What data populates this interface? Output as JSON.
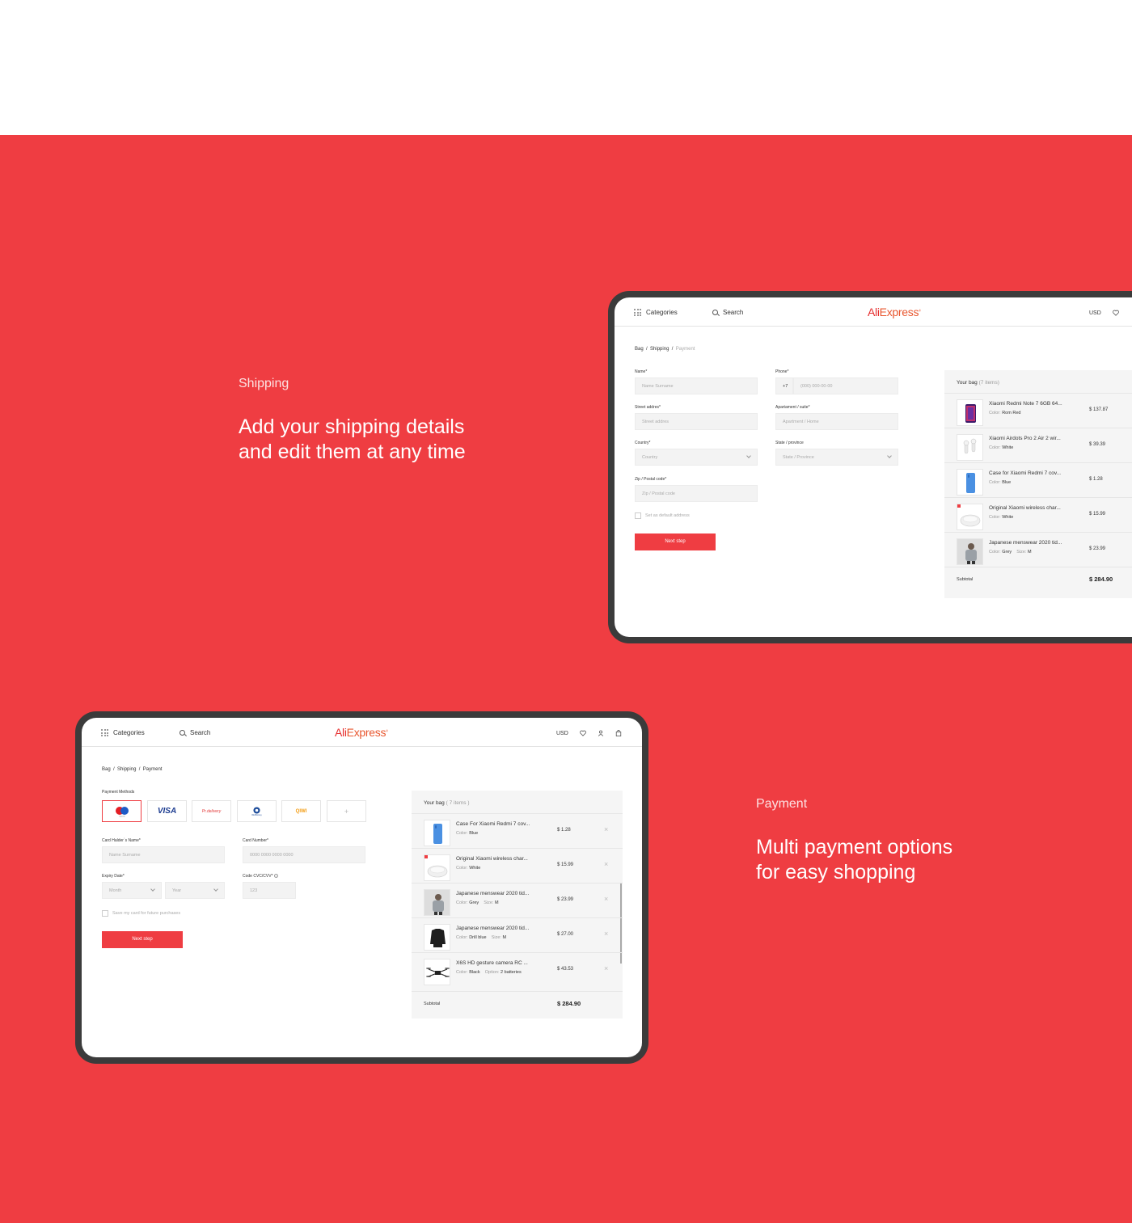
{
  "colors": {
    "accent": "#ef3d42",
    "brand": "#e62e2e",
    "frame": "#3b3b3b"
  },
  "shipping_caption": {
    "label": "Shipping",
    "title_line1": "Add your shipping details",
    "title_line2": "and edit them at any time"
  },
  "payment_caption": {
    "label": "Payment",
    "title_line1": "Multi payment options",
    "title_line2": "for easy shopping"
  },
  "header": {
    "categories": "Categories",
    "search": "Search",
    "logo_left": "Ali",
    "logo_right": "Express",
    "currency": "USD",
    "icons": [
      "heart-icon",
      "user-icon",
      "bag-icon"
    ]
  },
  "breadcrumb": {
    "bag": "Bag",
    "shipping": "Shipping",
    "payment": "Payment",
    "sep": "/"
  },
  "shipping_form": {
    "name_label": "Name*",
    "name_placeholder": "Name Surname",
    "phone_label": "Phone*",
    "phone_code": "+7",
    "phone_placeholder": "(000) 000-00-00",
    "street_label": "Street addres*",
    "street_placeholder": "Street addres",
    "apt_label": "Apartament / suite*",
    "apt_placeholder": "Apartment / Home",
    "country_label": "Country*",
    "country_placeholder": "Country",
    "state_label": "State / province",
    "state_placeholder": "State / Province",
    "zip_label": "Zip / Postal code*",
    "zip_placeholder": "Zip / Postal code",
    "default_label": "Set as default address",
    "next": "Next step"
  },
  "shipping_bag": {
    "title": "Your bag",
    "count": "(7 items)",
    "items": [
      {
        "name": "Xiaomi Redmi Note 7 6GB 64...",
        "color_label": "Color:",
        "color": "Rom Red",
        "price": "$ 137.87"
      },
      {
        "name": "Xiaomi Airdots Pro 2 Air 2 wir...",
        "color_label": "Color:",
        "color": "White",
        "price": "$ 39.39"
      },
      {
        "name": "Case for Xiaomi Redmi 7 cov...",
        "color_label": "Color:",
        "color": "Blue",
        "price": "$ 1.28"
      },
      {
        "name": "Original Xiaomi wireless char...",
        "color_label": "Color:",
        "color": "White",
        "price": "$ 15.99"
      },
      {
        "name": "Japanese menswear 2020 tid...",
        "color_label": "Color:",
        "color": "Grey",
        "size_label": "Size:",
        "size": "M",
        "price": "$ 23.99"
      }
    ],
    "subtotal_label": "Subtotal",
    "subtotal": "$ 284.90"
  },
  "payment_form": {
    "methods_label": "Payment Methods",
    "methods": [
      {
        "name": "maestro",
        "text": "maestro"
      },
      {
        "name": "visa",
        "text": "VISA"
      },
      {
        "name": "pr-delivery",
        "text": "Pr.delivery"
      },
      {
        "name": "webmoney",
        "text": "WebMoney"
      },
      {
        "name": "qiwi",
        "text": "QIWI"
      },
      {
        "name": "add",
        "text": "+"
      }
    ],
    "holder_label": "Card Halder`s Name*",
    "holder_placeholder": "Name Surname",
    "number_label": "Card Number*",
    "number_placeholder": "0000 0000 0000 0000",
    "expiry_label": "Expiry Date*",
    "month_placeholder": "Month",
    "year_placeholder": "Year",
    "cvc_label": "Code CVC/CVV*",
    "cvc_placeholder": "123",
    "save_label": "Save my card for future purchases",
    "next": "Next step"
  },
  "payment_bag": {
    "title": "Your bag",
    "count": "( 7 items )",
    "items": [
      {
        "name": "Case For Xiaomi Redmi 7 cov...",
        "color_label": "Color:",
        "color": "Blue",
        "price": "$ 1.28"
      },
      {
        "name": "Original Xiaomi wireless char...",
        "color_label": "Color:",
        "color": "White",
        "price": "$ 15.99"
      },
      {
        "name": "Japanese menswear 2020 tid...",
        "color_label": "Color:",
        "color": "Grey",
        "size_label": "Size:",
        "size": "M",
        "price": "$ 23.99"
      },
      {
        "name": "Japanese menswear 2020 tid...",
        "color_label": "Color:",
        "color": "Drill blue",
        "size_label": "Size:",
        "size": "M",
        "price": "$ 27.00"
      },
      {
        "name": "X6S HD gesture camera RC ...",
        "color_label": "Color:",
        "color": "Black",
        "option_label": "Option:",
        "option": "2 batteries",
        "price": "$ 43.53"
      }
    ],
    "subtotal_label": "Subtotal",
    "subtotal": "$ 284.90"
  }
}
